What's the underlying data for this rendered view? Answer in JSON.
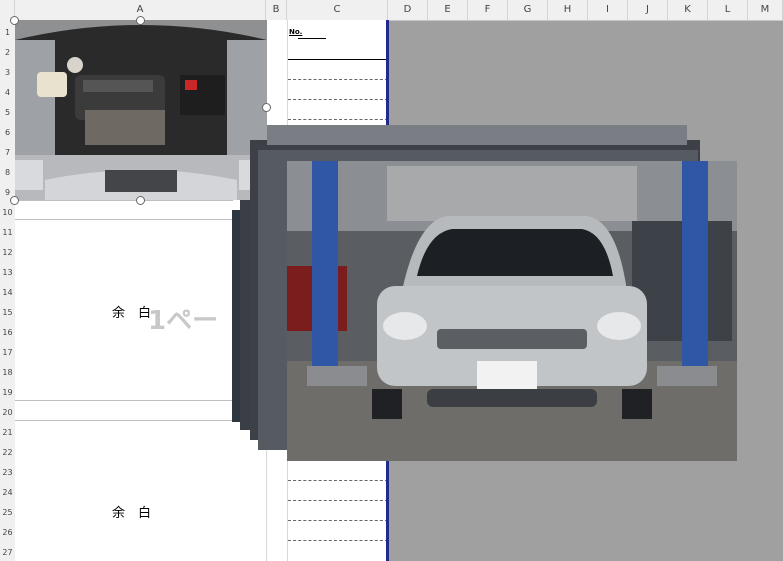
{
  "columns": [
    "A",
    "B",
    "C",
    "D",
    "E",
    "F",
    "G",
    "H",
    "I",
    "J",
    "K",
    "L",
    "M"
  ],
  "rows": [
    "1",
    "2",
    "3",
    "4",
    "5",
    "6",
    "7",
    "8",
    "9",
    "10",
    "11",
    "12",
    "13",
    "14",
    "15",
    "16",
    "17",
    "18",
    "19",
    "20",
    "21",
    "22",
    "23",
    "24",
    "25",
    "26",
    "27"
  ],
  "cell_c1": "No.",
  "blank_label_top": "余　白",
  "blank_label_bottom": "余　白",
  "page_watermark": "1ペー",
  "images": {
    "engine": "engine-bay-photo",
    "car": "silver-hatchback-in-garage-photo"
  }
}
